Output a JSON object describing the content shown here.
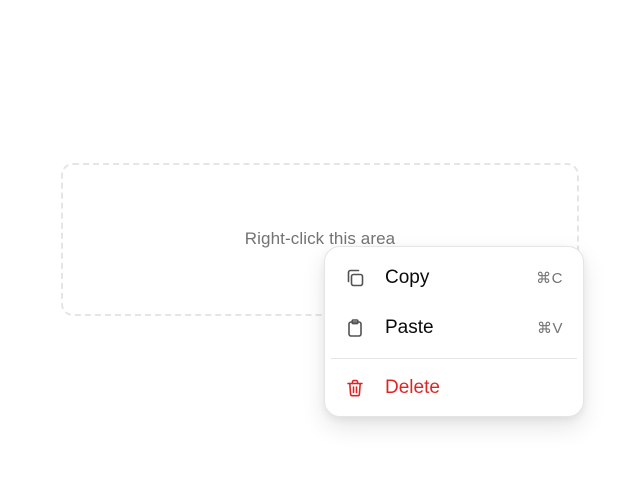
{
  "area": {
    "label": "Right-click this area"
  },
  "context_menu": {
    "items": [
      {
        "label": "Copy",
        "shortcut": "⌘C",
        "icon": "copy-icon"
      },
      {
        "label": "Paste",
        "shortcut": "⌘V",
        "icon": "clipboard-icon"
      },
      {
        "label": "Delete",
        "icon": "trash-icon",
        "color": "#dc2626"
      }
    ]
  },
  "colors": {
    "danger": "#dc2626",
    "muted_text": "#737373",
    "border": "#e5e5e5"
  }
}
